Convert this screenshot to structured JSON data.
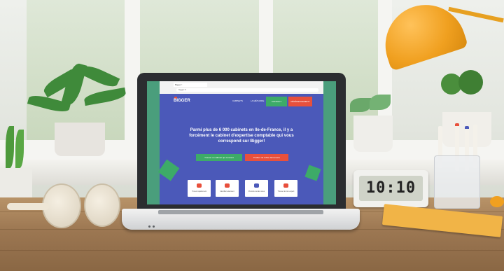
{
  "browser": {
    "tab_title": "Bigger !",
    "url": "bigger.fr"
  },
  "site": {
    "logo": "BIGGER",
    "nav": [
      {
        "label": "CABINETS"
      },
      {
        "label": "LA MÉTHODE"
      }
    ],
    "header_buttons": [
      {
        "label": "CONTACT",
        "color": "#3dab68"
      },
      {
        "label": "RÉFÉRENCEMENT",
        "color": "#e8503c"
      }
    ],
    "hero_text": "Parmi plus de 6 000 cabinets en Ile-de-France, il y a forcément le cabinet d'expertise comptable qui vous correspond sur Bigger!",
    "cta_buttons": [
      {
        "label": "Trouver un cabinet qui convient",
        "color": "#3dab68"
      },
      {
        "label": "Profitez de l'offre découverte",
        "color": "#e8503c"
      }
    ],
    "cards": [
      {
        "label": "Trouvé rapidement",
        "icon": "search-icon",
        "icon_color": "#e8503c"
      },
      {
        "label": "Identifier aisément",
        "icon": "building-icon",
        "icon_color": "#e8503c"
      },
      {
        "label": "Prendre rendez-vous",
        "icon": "send-icon",
        "icon_color": "#4b59b9"
      },
      {
        "label": "Trouver le bon expert",
        "icon": "lightbulb-icon",
        "icon_color": "#e8503c"
      }
    ],
    "colors": {
      "primary": "#4b59b9",
      "accent_green": "#3dab68",
      "accent_red": "#e8503c",
      "screen_border": "#4a9e7c"
    }
  },
  "clock": {
    "time": "10:10"
  }
}
